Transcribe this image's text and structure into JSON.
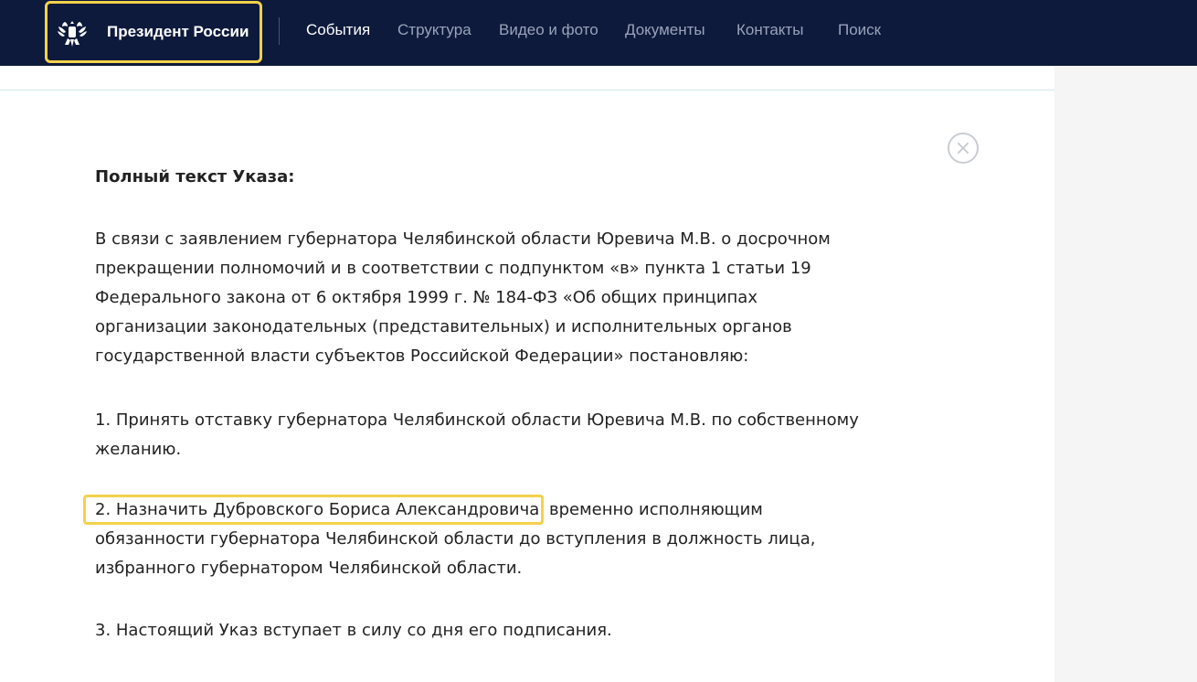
{
  "header": {
    "brand_title": "Президент России",
    "nav": [
      {
        "label": "События",
        "active": true
      },
      {
        "label": "Структура",
        "active": false
      },
      {
        "label": "Видео и фото",
        "active": false
      },
      {
        "label": "Документы",
        "active": false
      },
      {
        "label": "Контакты",
        "active": false
      },
      {
        "label": "Поиск",
        "active": false
      }
    ]
  },
  "document": {
    "heading": "Полный текст Указа:",
    "paragraph1": "В связи с заявлением губернатора Челябинской области Юревича М.В. о досрочном прекращении полномочий и в соответствии с подпунктом «в» пункта 1 статьи 19 Федерального закона от 6 октября 1999 г. № 184-ФЗ «Об общих принципах организации законодательных (представительных) и исполнительных органов государственной власти субъектов Российской Федерации» постановляю:",
    "paragraph2": "1. Принять отставку губернатора Челябинской области Юревича М.В. по собственному желанию.",
    "paragraph3_highlight": "2. Назначить Дубровского Бориса Александровича",
    "paragraph3_rest": " временно исполняющим обязанности губернатора Челябинской области до вступления в должность лица, избранного губернатором Челябинской области.",
    "paragraph4": "3. Настоящий Указ вступает в силу со дня его подписания."
  },
  "colors": {
    "header_bg": "#0d1a3c",
    "highlight": "#f3d24a",
    "text": "#222222"
  },
  "icons": {
    "emblem": "double-headed-eagle-icon",
    "close": "close-circle-icon"
  }
}
